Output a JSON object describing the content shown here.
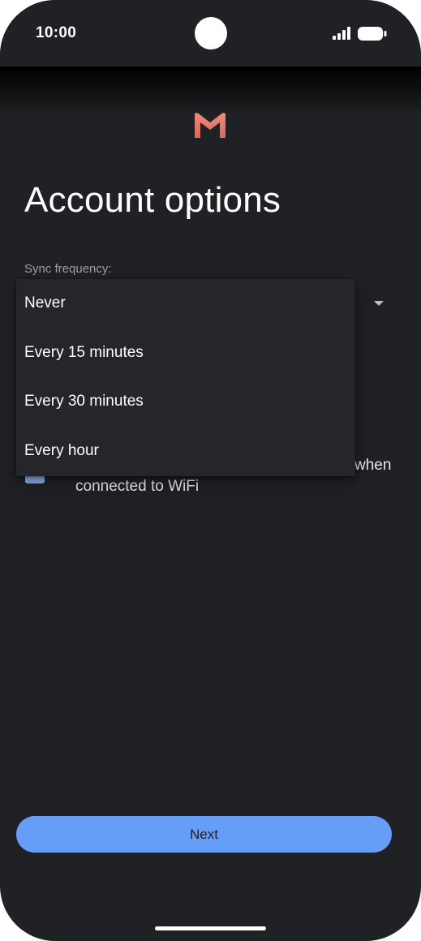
{
  "status_bar": {
    "time": "10:00",
    "icons": [
      "signal-icon",
      "battery-icon"
    ]
  },
  "app": {
    "logo": "gmail-m-logo-icon",
    "brand_color": "#e57368"
  },
  "page": {
    "title": "Account options"
  },
  "sync": {
    "label": "Sync frequency:",
    "options": [
      "Never",
      "Every 15 minutes",
      "Every 30 minutes",
      "Every hour"
    ],
    "dropdown_icon": "caret-down-icon"
  },
  "wifi_checkbox": {
    "checked": true,
    "label_visible_end": "when",
    "label_line2": "connected to WiFi"
  },
  "footer": {
    "next_label": "Next"
  },
  "colors": {
    "background": "#202124",
    "accent": "#669df6",
    "checkbox": "#8ab4f8"
  }
}
